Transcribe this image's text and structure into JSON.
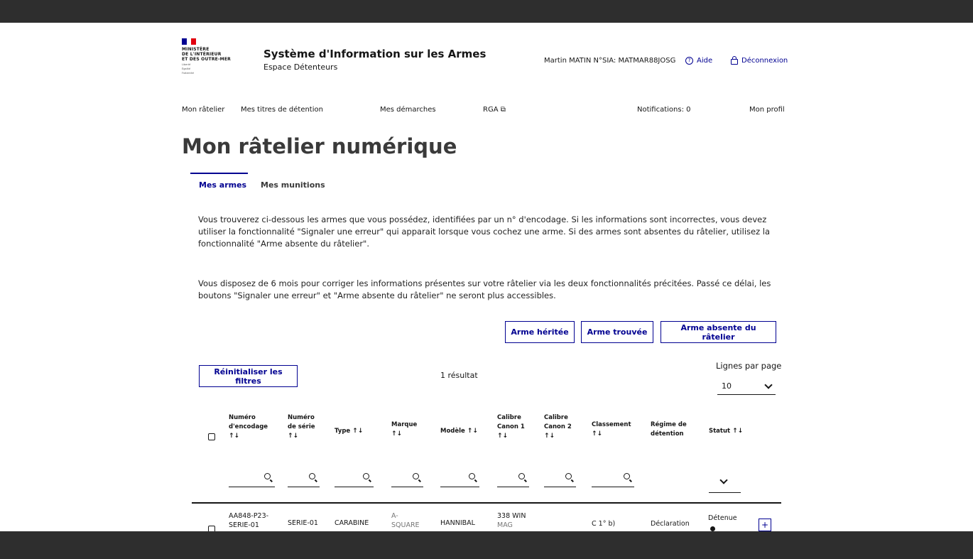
{
  "header": {
    "ministry": [
      "MINISTÈRE",
      "DE L'INTÉRIEUR",
      "ET DES OUTRE-MER"
    ],
    "motto": [
      "Liberté",
      "Égalité",
      "Fraternité"
    ],
    "title": "Système d'Information sur les Armes",
    "subtitle": "Espace Détenteurs",
    "user": "Martin MATIN N°SIA: MATMAR88JOSG",
    "help": "Aide",
    "logout": "Déconnexion"
  },
  "nav": {
    "rack": "Mon râtelier",
    "titles": "Mes titres de détention",
    "procedures": "Mes démarches",
    "rga": "RGA",
    "notifications": "Notifications: 0",
    "profile": "Mon profil"
  },
  "page_title": "Mon râtelier numérique",
  "tabs": {
    "weapons": "Mes armes",
    "ammo": "Mes munitions"
  },
  "info": {
    "p1": "Vous trouverez ci-dessous les armes que vous possédez, identifiées par un n° d'encodage. Si les informations sont incorrectes, vous devez utiliser la fonctionnalité \"Signaler une erreur\" qui apparait lorsque vous cochez une arme. Si des armes sont absentes du râtelier, utilisez la fonctionnalité \"Arme absente du râtelier\".",
    "p2": "Vous disposez de 6 mois pour corriger les informations présentes sur votre râtelier via les deux fonctionnalités précitées. Passé ce délai, les boutons \"Signaler une erreur\" et \"Arme absente du râtelier\" ne seront plus accessibles."
  },
  "actions": {
    "inherited": "Arme héritée",
    "found": "Arme trouvée",
    "absent": "Arme absente du râtelier",
    "reset": "Réinitialiser les filtres"
  },
  "results": "1 résultat",
  "rows_per_page": {
    "label": "Lignes par page",
    "value": "10"
  },
  "table": {
    "headers": {
      "encoding": [
        "Numéro",
        "d'encodage"
      ],
      "serial": [
        "Numéro",
        "de série"
      ],
      "type": "Type",
      "brand": "Marque",
      "model": "Modèle",
      "cal1": [
        "Calibre",
        "Canon 1"
      ],
      "cal2": [
        "Calibre",
        "Canon 2"
      ],
      "class": "Classement",
      "regime": [
        "Régime de",
        "détention"
      ],
      "status": "Statut"
    },
    "sort_icon": "↑↓",
    "row": {
      "encoding": [
        "AA848-P23-",
        "SERIE-01"
      ],
      "serial": "SERIE-01",
      "type": "CARABINE",
      "brand": [
        "A-",
        "SQUARE"
      ],
      "model": "HANNIBAL",
      "cal1": [
        "338 WIN",
        "MAG"
      ],
      "cal2": "",
      "class": "C 1° b)",
      "regime": "Déclaration",
      "status": "Détenue",
      "expand": "+"
    }
  },
  "icons": {
    "search": "search-icon",
    "external": "external-link-icon",
    "chevron": "chevron-down-icon"
  },
  "colors": {
    "primary": "#000091",
    "flag_blue": "#000091",
    "flag_red": "#e1000f"
  }
}
